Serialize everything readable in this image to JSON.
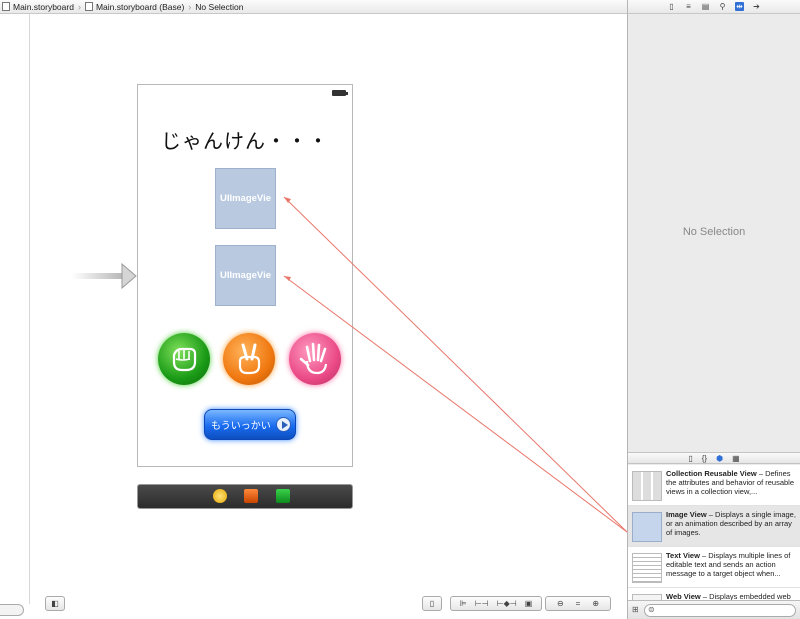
{
  "jumpbar": {
    "crumbs": [
      "Main.storyboard",
      "Main.storyboard (Base)",
      "No Selection"
    ]
  },
  "scene": {
    "title": "じゃんけん・・・",
    "image_view_1": "UIImageVie",
    "image_view_2": "UIImageVie",
    "again_button": "もういっかい"
  },
  "inspector": {
    "no_selection": "No Selection"
  },
  "library": {
    "items": [
      {
        "name": "Collection Reusable View",
        "desc": " – Defines the attributes and behavior of reusable views in a collection view,..."
      },
      {
        "name": "Image View",
        "desc": " – Displays a single image, or an animation described by an array of images."
      },
      {
        "name": "Text View",
        "desc": " – Displays multiple lines of editable text and sends an action message to a target object when..."
      },
      {
        "name": "Web View",
        "desc": " – Displays embedded web"
      }
    ]
  },
  "colors": {
    "connection_line": "#e8766a",
    "image_view_fill": "#b9c9e0"
  }
}
